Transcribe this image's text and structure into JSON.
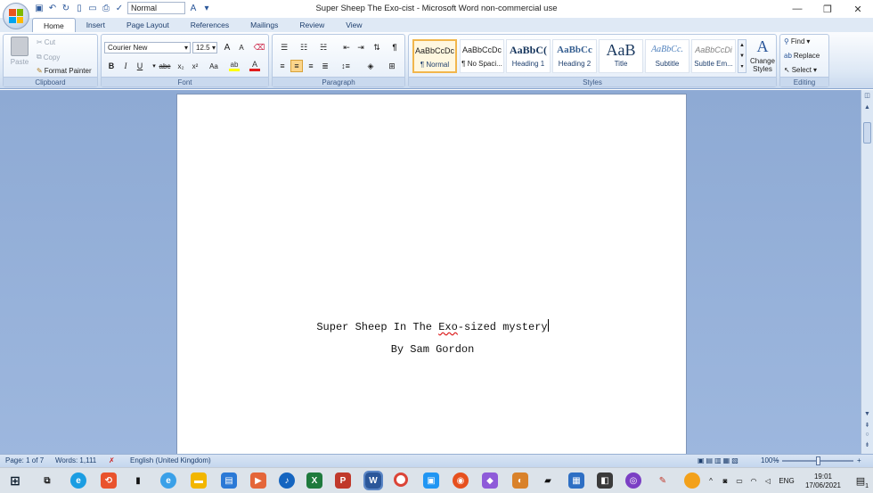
{
  "window": {
    "title": "Super Sheep The Exo-cist - Microsoft Word non-commercial use",
    "qat_style": "Normal"
  },
  "tabs": [
    "Home",
    "Insert",
    "Page Layout",
    "References",
    "Mailings",
    "Review",
    "View"
  ],
  "clipboard": {
    "paste": "Paste",
    "cut": "Cut",
    "copy": "Copy",
    "format_painter": "Format Painter",
    "label": "Clipboard"
  },
  "font": {
    "family": "Courier New",
    "size": "12.5",
    "label": "Font",
    "bold": "B",
    "italic": "I",
    "underline": "U",
    "strike": "abc",
    "sub": "x₂",
    "sup": "x²",
    "case": "Aa",
    "grow": "A",
    "shrink": "A"
  },
  "paragraph": {
    "label": "Paragraph",
    "pilcrow": "¶"
  },
  "styles": {
    "label": "Styles",
    "items": [
      {
        "sample": "AaBbCcDc",
        "name": "¶ Normal"
      },
      {
        "sample": "AaBbCcDc",
        "name": "¶ No Spaci..."
      },
      {
        "sample": "AaBbC(",
        "name": "Heading 1"
      },
      {
        "sample": "AaBbCc",
        "name": "Heading 2"
      },
      {
        "sample": "AaB",
        "name": "Title"
      },
      {
        "sample": "AaBbCc.",
        "name": "Subtitle"
      },
      {
        "sample": "AaBbCcDi",
        "name": "Subtle Em..."
      }
    ],
    "change_styles": "Change Styles"
  },
  "editing": {
    "label": "Editing",
    "find": "Find",
    "replace": "Replace",
    "select": "Select"
  },
  "document": {
    "title_before": "Super Sheep In The ",
    "title_misspelled": "Exo",
    "title_after": "-sized mystery",
    "byline": "By Sam Gordon"
  },
  "status": {
    "page": "Page: 1 of 7",
    "words": "Words: 1,111",
    "language": "English (United Kingdom)",
    "zoom": "100%"
  },
  "taskbar": {
    "language": "ENG",
    "time": "19:01",
    "date": "17/06/2021",
    "notifications": "1"
  },
  "colors": {
    "accent": "#2b579a",
    "highlight": "#fbd58b",
    "doc_background": "#9db7de"
  }
}
